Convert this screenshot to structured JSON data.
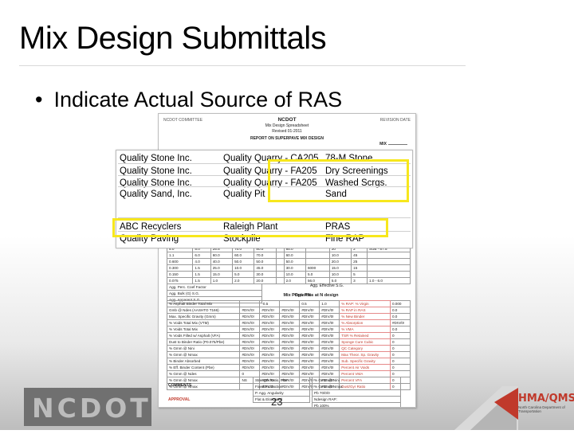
{
  "slide": {
    "title": "Mix Design Submittals",
    "bullet_symbol": "•",
    "bullet": "Indicate Actual Source of RAS",
    "page_number": "23"
  },
  "sheet": {
    "header_left": "NCDOT COMMITTEE",
    "header_right": "REVISION DATE",
    "org": "NCDOT",
    "line1": "Mix Design Spreadsheet",
    "line2": "Revised 01-2011",
    "line3": "REPORT ON SUPERPAVE MIX DESIGN",
    "mix_label": "MIX",
    "rows_top": [
      [
        "5.0",
        "5.0",
        "25.5",
        "70.0",
        "80.0",
        "",
        "85.0",
        "",
        "20",
        "2",
        "SUB - 67.5"
      ],
      [
        "1.1",
        "6.0",
        "60.0",
        "60.0",
        "70.0",
        "",
        "60.0",
        "",
        "10.0",
        "45",
        ""
      ],
      [
        "0.600",
        "4.0",
        "40.0",
        "50.0",
        "50.0",
        "",
        "50.0",
        "",
        "20.0",
        "25",
        ""
      ],
      [
        "0.300",
        "1.5",
        "25.0",
        "10.0",
        "45.0",
        "",
        "30.0",
        "6000",
        "15.0",
        "15",
        ""
      ],
      [
        "0.150",
        "1.5",
        "15.0",
        "5.0",
        "30.0",
        "",
        "10.0",
        "5.0",
        "10.0",
        "5",
        ""
      ],
      [
        "0.075",
        "1.5",
        "1.0",
        "2.0",
        "20.0",
        "",
        "2.0",
        "56.0",
        "5.0",
        "3",
        "1.0 - 6.0"
      ]
    ],
    "sub_rows": [
      "Agg. Perc. Coef Factor",
      "Agg. Bulk (G) S.G.",
      "Agg. Apparent S.G."
    ],
    "effective_label": "Agg. Effective S.G.",
    "properties_title": "Mix Properties at N design",
    "opt_label": "Opt. P%",
    "prop_rows": [
      [
        "% Asphalt Binder Total Mix",
        "",
        "-0.5",
        "",
        "0.5",
        "1.0",
        "% RAP: % Virgin",
        "0.000"
      ],
      [
        "Gmb @ Ndes (AASHTO T166)",
        "#DIV/0!",
        "#DIV/0!",
        "#DIV/0!",
        "#DIV/0!",
        "#DIV/0!",
        "% RAP in RAS",
        "0.0"
      ],
      [
        "Max. Specific Gravity (Gmm)",
        "#DIV/0!",
        "#DIV/0!",
        "#DIV/0!",
        "#DIV/0!",
        "#DIV/0!",
        "% New Binder",
        "0.0"
      ],
      [
        "% Voids Total Mix (VTM)",
        "#DIV/0!",
        "#DIV/0!",
        "#DIV/0!",
        "#DIV/0!",
        "#DIV/0!",
        "% Absorption",
        "#DIV/0!"
      ],
      [
        "% Voids Total Mix",
        "#DIV/0!",
        "#DIV/0!",
        "#DIV/0!",
        "#DIV/0!",
        "#DIV/0!",
        "% VMA",
        "0.0"
      ],
      [
        "% Voids Filled w/ Asphalt (VFA)",
        "#DIV/0!",
        "#DIV/0!",
        "#DIV/0!",
        "#DIV/0!",
        "#DIV/0!",
        "TSR % Retained",
        "0"
      ],
      [
        "Dust to Binder Ratio (P0.075/Pbe)",
        "#DIV/0!",
        "#DIV/0!",
        "#DIV/0!",
        "#DIV/0!",
        "#DIV/0!",
        "Sponge Cure Cubic",
        "0"
      ],
      [
        "% Gmm @ Nini",
        "#DIV/0!",
        "#DIV/0!",
        "#DIV/0!",
        "#DIV/0!",
        "#DIV/0!",
        "QC Category",
        "0"
      ],
      [
        "% Gmm @ Nmax",
        "#DIV/0!",
        "#DIV/0!",
        "#DIV/0!",
        "#DIV/0!",
        "#DIV/0!",
        "Max Theor. Sp. Gravity",
        "0"
      ],
      [
        "% Binder Absorbed",
        "#DIV/0!",
        "#DIV/0!",
        "#DIV/0!",
        "#DIV/0!",
        "#DIV/0!",
        "Sub. Specific Gravity",
        "0"
      ],
      [
        "% Eff. Binder Content (Pbe)",
        "#DIV/0!",
        "#DIV/0!",
        "#DIV/0!",
        "#DIV/0!",
        "#DIV/0!",
        "Percent Air Voids",
        "0"
      ],
      [
        "% Gmm @ Ndes",
        "0",
        "#DIV/0!",
        "#DIV/0!",
        "#DIV/0!",
        "#DIV/0!",
        "Percent VMA",
        "0"
      ],
      [
        "% Gmm @ Nmax",
        "NS",
        "#DIV/0!",
        "#DIV/0!",
        "#DIV/0!",
        "#DIV/0!",
        "Percent VFA",
        "0"
      ],
      [
        "% Gmm @ Nmax",
        "",
        "#DIV/0!",
        "#DIV/0!",
        "#DIV/0!",
        "#DIV/0!",
        "Dust/Gyr Ratio",
        "0"
      ]
    ],
    "comments_label": "COMMENTS",
    "approved_label": "APPROVAL",
    "footer_rows": [
      "Strength Ratio, Pbe*",
      "Fixed Production",
      "P. Agg. Angularity",
      "Flat & Elongated"
    ],
    "footer_right": [
      "% Gmm @ Nini",
      "% Gmm @ Nmax",
      "Pb 70/0/0",
      "Ndesign RAP:",
      "Pb 100%"
    ]
  },
  "overlay": {
    "rows": [
      {
        "producer": "Quality Stone Inc.",
        "location": "Quality Quarry - CA205",
        "material": "78-M Stone"
      },
      {
        "producer": "Quality Stone Inc.",
        "location": "Quality Quarry - FA205",
        "material": "Dry Screenings"
      },
      {
        "producer": "Quality Stone Inc.",
        "location": "Quality Quarry - FA205",
        "material": "Washed Scrgs."
      },
      {
        "producer": "Quality Sand, Inc.",
        "location": "Quality Pit",
        "material": "Sand"
      },
      {
        "producer": "ABC Recyclers",
        "location": "Raleigh Plant",
        "material": "PRAS"
      },
      {
        "producer": "Quality Paving",
        "location": "Stockpile",
        "material": "Fine RAP"
      }
    ],
    "highlight_color": "#f7e71d"
  },
  "logos": {
    "left": "NCDOT",
    "right": "HMA/QMS",
    "right_sub": "North Carolina Department of Transportation"
  }
}
